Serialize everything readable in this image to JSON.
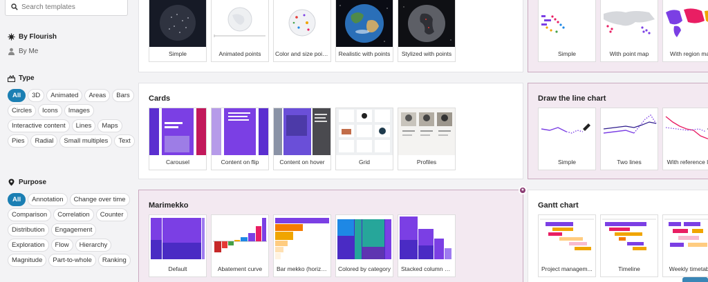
{
  "search": {
    "placeholder": "Search templates"
  },
  "owners": {
    "flourish": "By Flourish",
    "me": "By Me"
  },
  "filters": {
    "type": {
      "heading": "Type",
      "chips": [
        "All",
        "3D",
        "Animated",
        "Areas",
        "Bars",
        "Circles",
        "Icons",
        "Images",
        "Interactive content",
        "Lines",
        "Maps",
        "Pies",
        "Radial",
        "Small multiples",
        "Text"
      ],
      "active": "All"
    },
    "purpose": {
      "heading": "Purpose",
      "chips": [
        "All",
        "Annotation",
        "Change over time",
        "Comparison",
        "Correlation",
        "Counter",
        "Distribution",
        "Engagement",
        "Exploration",
        "Flow",
        "Hierarchy",
        "Magnitude",
        "Part-to-whole",
        "Ranking"
      ],
      "active": "All"
    }
  },
  "sections": {
    "globe": {
      "cards": [
        "Simple",
        "Animated points",
        "Color and size points",
        "Realistic with points",
        "Stylized with points"
      ]
    },
    "dotmap": {
      "cards": [
        "Simple",
        "With point map",
        "With region map"
      ]
    },
    "cards_section": {
      "title": "Cards",
      "cards": [
        "Carousel",
        "Content on flip",
        "Content on hover",
        "Grid",
        "Profiles"
      ]
    },
    "drawline": {
      "title": "Draw the line chart",
      "cards": [
        "Simple",
        "Two lines",
        "With reference line"
      ]
    },
    "marimekko": {
      "title": "Marimekko",
      "cards": [
        "Default",
        "Abatement curve",
        "Bar mekko (horizo...",
        "Colored by category",
        "Stacked column m..."
      ]
    },
    "gantt": {
      "title": "Gantt chart",
      "cards": [
        "Project managem...",
        "Timeline",
        "Weekly timetable"
      ]
    }
  },
  "colors": {
    "accent": "#1b7fb3",
    "featured_bg": "#f3e9f1",
    "featured_border": "#c9a9bf",
    "purple": "#7b3fe4"
  },
  "icons": [
    "search-icon",
    "flourish-logo-icon",
    "user-icon",
    "type-icon",
    "purpose-icon",
    "star-icon"
  ]
}
